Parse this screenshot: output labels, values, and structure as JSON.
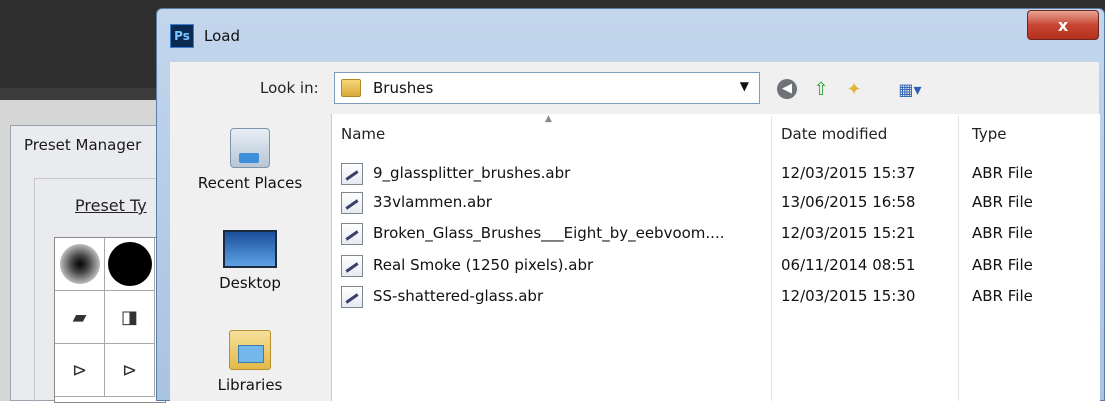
{
  "background_window": {
    "title": "Preset Manager",
    "preset_type_label": "Preset Ty"
  },
  "dialog": {
    "app_badge": "Ps",
    "title": "Load",
    "close_symbol": "x"
  },
  "lookin": {
    "label": "Look in:",
    "value": "Brushes"
  },
  "toolbar": {
    "back_icon": "back-arrow-icon",
    "up_icon": "up-folder-icon",
    "new_folder_icon": "new-folder-icon",
    "view_icon": "view-menu-icon"
  },
  "places": [
    {
      "label": "Recent Places",
      "icon": "recent-places-icon"
    },
    {
      "label": "Desktop",
      "icon": "desktop-icon"
    },
    {
      "label": "Libraries",
      "icon": "libraries-icon"
    }
  ],
  "columns": {
    "name": "Name",
    "date": "Date modified",
    "type": "Type"
  },
  "files": [
    {
      "name": "9_glassplitter_brushes.abr",
      "date": "12/03/2015 15:37",
      "type": "ABR File"
    },
    {
      "name": "33vlammen.abr",
      "date": "13/06/2015 16:58",
      "type": "ABR File"
    },
    {
      "name": "Broken_Glass_Brushes___Eight_by_eebvoom....",
      "date": "12/03/2015 15:21",
      "type": "ABR File"
    },
    {
      "name": "Real Smoke (1250 pixels).abr",
      "date": "06/11/2014 08:51",
      "type": "ABR File"
    },
    {
      "name": "SS-shattered-glass.abr",
      "date": "12/03/2015 15:30",
      "type": "ABR File"
    }
  ],
  "colors": {
    "ps_dark": "#2e2e2e",
    "title_bar": "#b8cfea",
    "close_red": "#c74633"
  }
}
